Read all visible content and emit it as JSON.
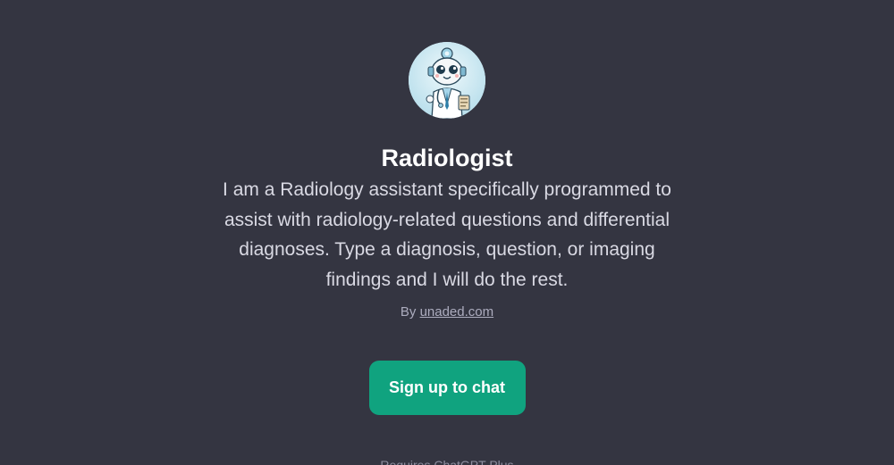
{
  "gpt": {
    "avatar_icon": "robot-doctor-avatar",
    "name": "Radiologist",
    "description": "I am a Radiology assistant specifically programmed to assist with radiology-related questions and differential diagnoses. Type a diagnosis, question, or imaging findings and I will do the rest.",
    "byline_prefix": "By",
    "author_link": "unaded.com"
  },
  "cta": {
    "signup_label": "Sign up to chat"
  },
  "footer": {
    "text": "Requires ChatGPT Plus"
  },
  "colors": {
    "background": "#343541",
    "accent": "#10a37f"
  }
}
